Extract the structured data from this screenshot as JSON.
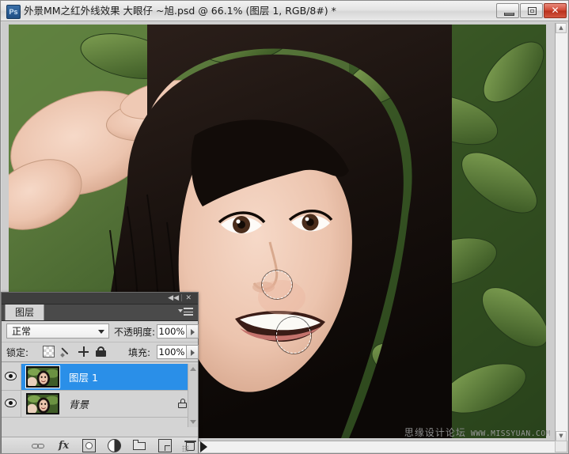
{
  "window": {
    "app_icon": "Ps",
    "title": "外景MM之红外线效果 大眼仔 ~旭.psd @ 66.1% (图层 1, RGB/8#) *",
    "minimize_label": "",
    "maximize_label": "",
    "close_label": "✕"
  },
  "panel": {
    "topbar": {
      "collapse_icon": "◀◀",
      "close_icon": "✕"
    },
    "tab_label": "图层",
    "menu_icon": "panel-menu-icon",
    "blend": {
      "mode_label": "正常",
      "opacity_label": "不透明度:",
      "opacity_value": "100%"
    },
    "lock": {
      "label": "锁定:",
      "icons": [
        "lock-transparent-pixels-icon",
        "lock-image-pixels-icon",
        "lock-position-icon",
        "lock-all-icon"
      ],
      "fill_label": "填充:",
      "fill_value": "100%"
    },
    "layers": [
      {
        "name": "图层 1",
        "selected": true,
        "visible": true,
        "locked": false
      },
      {
        "name": "背景",
        "selected": false,
        "visible": true,
        "locked": true
      }
    ],
    "footer_icons": [
      "link-layers-icon",
      "layer-style-fx-icon",
      "add-layer-mask-icon",
      "new-adjustment-layer-icon",
      "new-group-icon",
      "new-layer-icon",
      "delete-layer-icon"
    ],
    "fx_glyph": "fx"
  },
  "canvas": {
    "zoom": "66.1%",
    "watermark_cn": "思缘设计论坛",
    "watermark_en": "WWW.MISSYUAN.COM",
    "selections": [
      {
        "name": "lasso-selection-upper-cheek"
      },
      {
        "name": "lasso-selection-lower-cheek"
      }
    ]
  },
  "scrollbars": {
    "vertical_up": "▲",
    "vertical_down": "▼",
    "horizontal_left": "◀"
  },
  "colors": {
    "accent_selected_layer": "#2a8fe8",
    "close_button": "#cf4733",
    "panel_bg": "#d4d4d4",
    "panel_header": "#3e3e3e"
  }
}
